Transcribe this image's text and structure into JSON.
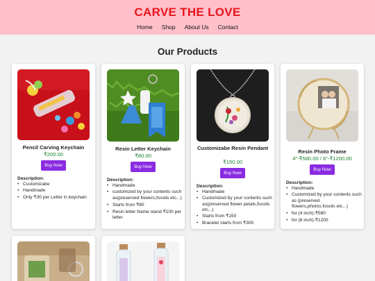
{
  "site": {
    "title": "CARVE THE LOVE"
  },
  "nav": [
    "Home",
    "Shop",
    "About Us",
    "Contact"
  ],
  "section": {
    "title": "Our Products"
  },
  "products": [
    {
      "name": "Pencil Carving Keychain",
      "price": "₹200.00",
      "button": "Buy Now",
      "desc_title": "Description:",
      "desc": [
        "Customizabe",
        "Handmade",
        "Only ₹30 per Letter in keychain"
      ]
    },
    {
      "name": "Resin Letter Keychain",
      "price": "₹80.00",
      "button": "Buy Now",
      "desc_title": "Description:",
      "desc": [
        "Handmade",
        "customized by your contents such as(preserved flowers,fossils etc...)",
        "Starts from ₹80",
        "Resin letter Name stand ₹100 per letter"
      ]
    },
    {
      "name": "Customizabe Resin Pendant",
      "price": "₹150.00",
      "button": "Buy Now",
      "desc_title": "Description:",
      "desc": [
        "Handmade",
        "Customized by your contents such as(preserved flower petals,fossils etc...)",
        "Starts from ₹150",
        "Bracelet starts from ₹300"
      ]
    },
    {
      "name": "Resin Photo Frame",
      "price": "4\"-₹580.00 / 8\"-₹1200.00",
      "button": "Buy Now",
      "desc_title": "Description:",
      "desc": [
        "Handmade",
        "Customized by your contents such as (preserved flowers,photos,fossils etc...)",
        "for (4 inch)-₹580",
        "for (8 inch)-₹1200"
      ]
    }
  ],
  "images": {
    "p1": "pencil-keychain-photo",
    "p2": "resin-letter-keychain-photo",
    "p3": "resin-pendant-photo",
    "p4": "resin-photo-frame-photo",
    "p5": "product-photo",
    "p6": "bottle-name-photo"
  }
}
